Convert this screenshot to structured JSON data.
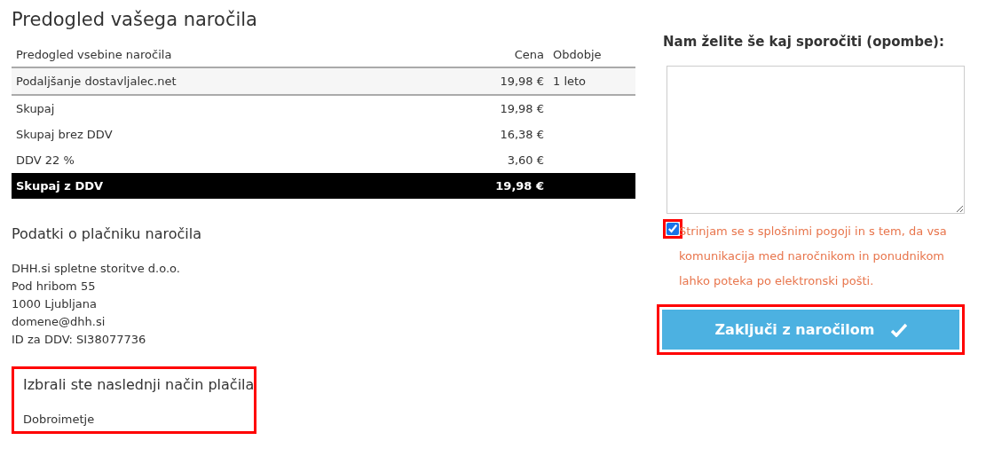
{
  "title": "Predogled vašega naročila",
  "order_table": {
    "columns": [
      "Predogled vsebine naročila",
      "Cena",
      "Obdobje"
    ],
    "items": [
      {
        "name": "Podaljšanje dostavljalec.net",
        "price": "19,98 €",
        "period": "1 leto"
      }
    ],
    "summary": [
      {
        "label": "Skupaj",
        "price": "19,98 €",
        "kind": "plain"
      },
      {
        "label": "Skupaj brez DDV",
        "price": "16,38 €",
        "kind": "plain"
      },
      {
        "label": "DDV 22 %",
        "price": "3,60 €",
        "kind": "plain"
      },
      {
        "label": "Skupaj z DDV",
        "price": "19,98 €",
        "kind": "total"
      }
    ]
  },
  "payer": {
    "heading": "Podatki o plačniku naročila",
    "lines": [
      "DHH.si spletne storitve d.o.o.",
      "Pod hribom 55",
      "1000 Ljubljana",
      "domene@dhh.si",
      "ID za DDV: SI38077736"
    ]
  },
  "payment": {
    "heading": "Izbrali ste naslednji način plačila",
    "method": "Dobroimetje",
    "highlighted": true
  },
  "notes": {
    "label": "Nam želite še kaj sporočiti (opombe):"
  },
  "terms": {
    "checked": true,
    "highlighted": true,
    "text": "Strinjam se s splošnimi pogoji in s tem, da vsa komunikacija med naročnikom in ponudnikom lahko poteka po elektronski pošti."
  },
  "submit": {
    "label": "Zaključi z naročilom",
    "highlighted": true
  }
}
